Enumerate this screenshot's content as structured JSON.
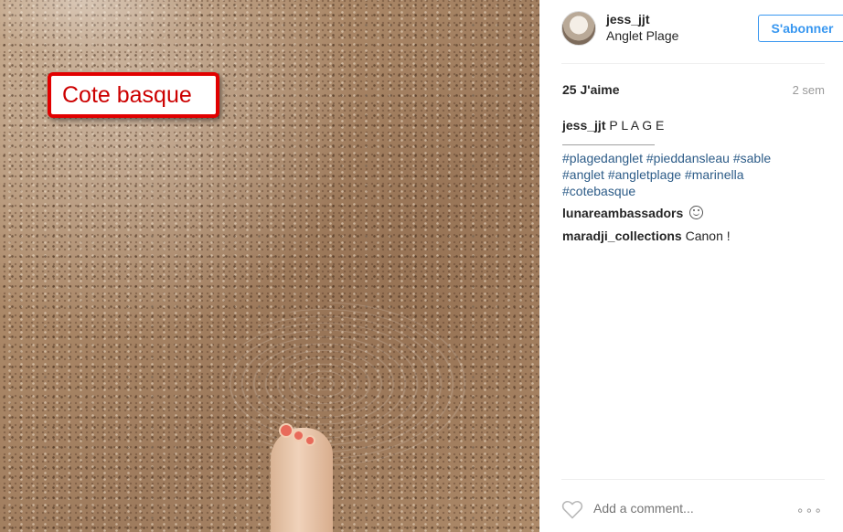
{
  "photo": {
    "overlay_label": "Cote basque"
  },
  "post": {
    "username": "jess_jjt",
    "location": "Anglet Plage",
    "follow_label": "S'abonner",
    "likes": "25 J'aime",
    "age": "2 sem",
    "caption": {
      "username": "jess_jjt",
      "text": "P L A G E"
    },
    "hashtags": {
      "line1": [
        "#plagedanglet",
        "#pieddansleau",
        "#sable"
      ],
      "line2": [
        "#anglet",
        "#angletplage",
        "#marinella"
      ],
      "line3": [
        "#cotebasque"
      ]
    },
    "comments": [
      {
        "username": "lunareambassadors",
        "text": "",
        "emoji": "smiley-icon"
      },
      {
        "username": "maradji_collections",
        "text": "Canon !"
      }
    ],
    "comment_placeholder": "Add a comment...",
    "more_label": "∘∘∘"
  },
  "colors": {
    "link": "#2d5c88",
    "follow_accent": "#3897f0",
    "overlay_border": "#e10000"
  }
}
